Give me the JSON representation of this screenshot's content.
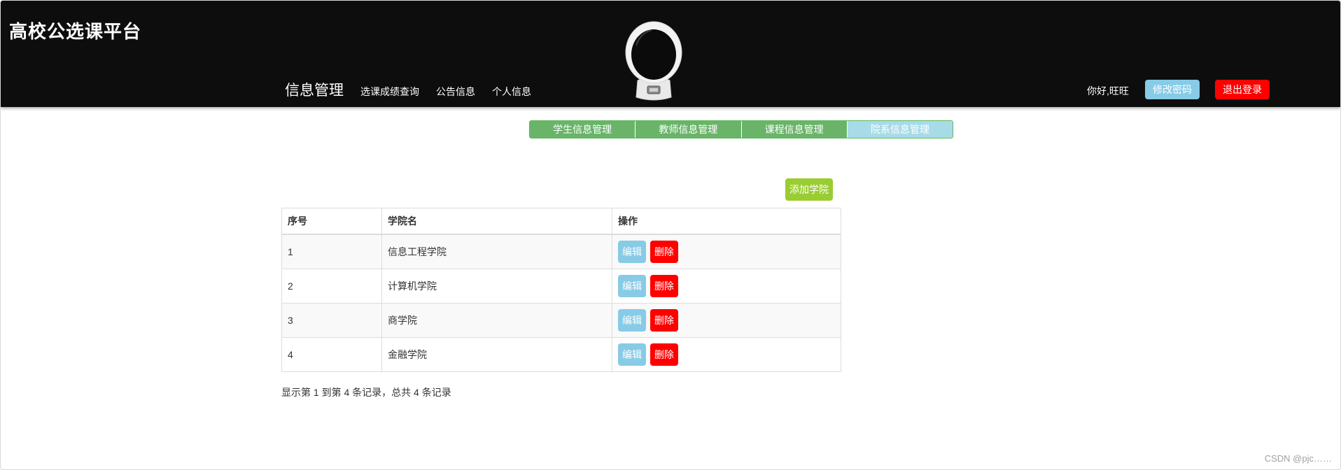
{
  "header": {
    "site_title": "高校公选课平台",
    "nav": {
      "brand": "信息管理",
      "links": [
        "选课成绩查询",
        "公告信息",
        "个人信息"
      ]
    },
    "greeting": "你好,旺旺",
    "change_password_label": "修改密码",
    "logout_label": "退出登录"
  },
  "subtabs": [
    {
      "label": "学生信息管理",
      "active": false
    },
    {
      "label": "教师信息管理",
      "active": false
    },
    {
      "label": "课程信息管理",
      "active": false
    },
    {
      "label": "院系信息管理",
      "active": true
    }
  ],
  "toolbar": {
    "add_label": "添加学院"
  },
  "table": {
    "headers": [
      "序号",
      "学院名",
      "操作"
    ],
    "rows": [
      {
        "no": "1",
        "name": "信息工程学院"
      },
      {
        "no": "2",
        "name": "计算机学院"
      },
      {
        "no": "3",
        "name": "商学院"
      },
      {
        "no": "4",
        "name": "金融学院"
      }
    ],
    "edit_label": "编辑",
    "delete_label": "删除"
  },
  "pagination": {
    "info": "显示第 1 到第 4 条记录，总共 4 条记录"
  },
  "watermark": "CSDN @pjc……",
  "colors": {
    "header_bg": "#0d0d0d",
    "tab_green": "#6ab46a",
    "tab_active": "#a8dbe8",
    "add_button": "#9acd32",
    "edit_button": "#87cbe6",
    "delete_button": "#ff0000"
  },
  "icons": {
    "avatar": "astronaut-helmet-icon"
  }
}
